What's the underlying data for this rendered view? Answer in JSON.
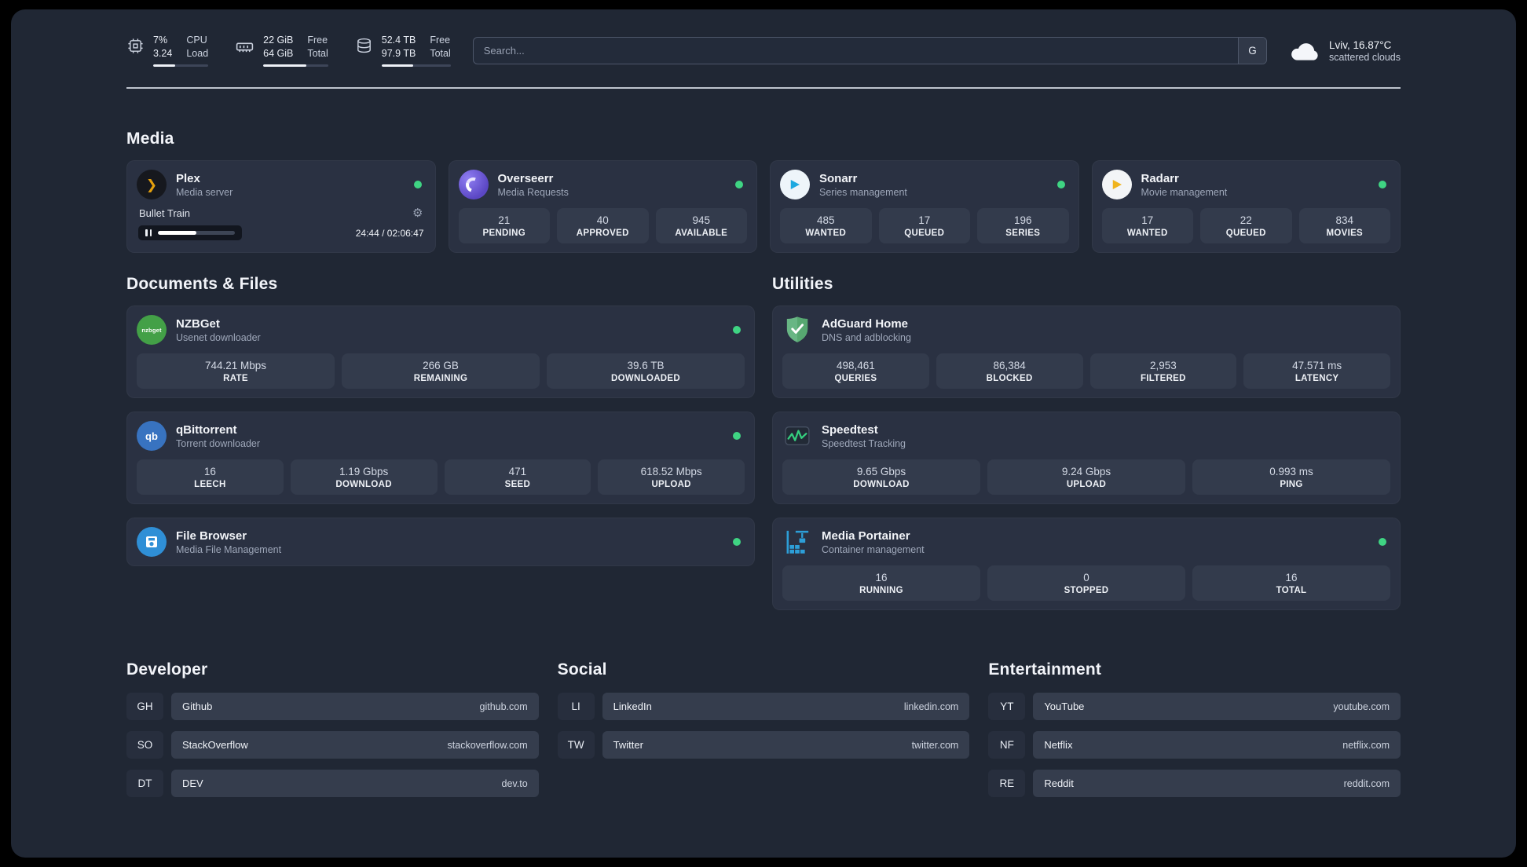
{
  "icons": {
    "gear": "⚙",
    "plex_glyph": "❯"
  },
  "topbar": {
    "cpu": {
      "value1": "7%",
      "value2": "3.24",
      "label1": "CPU",
      "label2": "Load",
      "bar_style": "width:40%"
    },
    "ram": {
      "value1": "22 GiB",
      "value2": "64 GiB",
      "label1": "Free",
      "label2": "Total",
      "bar_style": "width:66%"
    },
    "disk": {
      "value1": "52.4 TB",
      "value2": "97.9 TB",
      "label1": "Free",
      "label2": "Total",
      "bar_style": "width:46%"
    },
    "search": {
      "placeholder": "Search...",
      "engine_button": "G"
    },
    "weather": {
      "location": "Lviv, 16.87°C",
      "condition": "scattered clouds"
    }
  },
  "sections": {
    "media": {
      "title": "Media",
      "plex": {
        "title": "Plex",
        "subtitle": "Media server",
        "now_playing": "Bullet Train",
        "time": "24:44 / 02:06:47",
        "progress_style": "width:50%"
      },
      "overseerr": {
        "title": "Overseerr",
        "subtitle": "Media Requests",
        "stats": [
          {
            "value": "21",
            "label": "PENDING"
          },
          {
            "value": "40",
            "label": "APPROVED"
          },
          {
            "value": "945",
            "label": "AVAILABLE"
          }
        ]
      },
      "sonarr": {
        "title": "Sonarr",
        "subtitle": "Series management",
        "stats": [
          {
            "value": "485",
            "label": "WANTED"
          },
          {
            "value": "17",
            "label": "QUEUED"
          },
          {
            "value": "196",
            "label": "SERIES"
          }
        ]
      },
      "radarr": {
        "title": "Radarr",
        "subtitle": "Movie management",
        "stats": [
          {
            "value": "17",
            "label": "WANTED"
          },
          {
            "value": "22",
            "label": "QUEUED"
          },
          {
            "value": "834",
            "label": "MOVIES"
          }
        ]
      }
    },
    "documents": {
      "title": "Documents & Files",
      "nzbget": {
        "title": "NZBGet",
        "subtitle": "Usenet downloader",
        "icon_text": "nzbget",
        "stats": [
          {
            "value": "744.21 Mbps",
            "label": "RATE"
          },
          {
            "value": "266 GB",
            "label": "REMAINING"
          },
          {
            "value": "39.6 TB",
            "label": "DOWNLOADED"
          }
        ]
      },
      "qbittorrent": {
        "title": "qBittorrent",
        "subtitle": "Torrent downloader",
        "icon_text": "qb",
        "stats": [
          {
            "value": "16",
            "label": "LEECH"
          },
          {
            "value": "1.19 Gbps",
            "label": "DOWNLOAD"
          },
          {
            "value": "471",
            "label": "SEED"
          },
          {
            "value": "618.52 Mbps",
            "label": "UPLOAD"
          }
        ]
      },
      "filebrowser": {
        "title": "File Browser",
        "subtitle": "Media File Management"
      }
    },
    "utilities": {
      "title": "Utilities",
      "adguard": {
        "title": "AdGuard Home",
        "subtitle": "DNS and adblocking",
        "stats": [
          {
            "value": "498,461",
            "label": "QUERIES"
          },
          {
            "value": "86,384",
            "label": "BLOCKED"
          },
          {
            "value": "2,953",
            "label": "FILTERED"
          },
          {
            "value": "47.571 ms",
            "label": "LATENCY"
          }
        ]
      },
      "speedtest": {
        "title": "Speedtest",
        "subtitle": "Speedtest Tracking",
        "stats": [
          {
            "value": "9.65 Gbps",
            "label": "DOWNLOAD"
          },
          {
            "value": "9.24 Gbps",
            "label": "UPLOAD"
          },
          {
            "value": "0.993 ms",
            "label": "PING"
          }
        ]
      },
      "portainer": {
        "title": "Media Portainer",
        "subtitle": "Container management",
        "stats": [
          {
            "value": "16",
            "label": "RUNNING"
          },
          {
            "value": "0",
            "label": "STOPPED"
          },
          {
            "value": "16",
            "label": "TOTAL"
          }
        ]
      }
    }
  },
  "bookmarks": {
    "developer": {
      "title": "Developer",
      "links": [
        {
          "abbr": "GH",
          "name": "Github",
          "url": "github.com"
        },
        {
          "abbr": "SO",
          "name": "StackOverflow",
          "url": "stackoverflow.com"
        },
        {
          "abbr": "DT",
          "name": "DEV",
          "url": "dev.to"
        }
      ]
    },
    "social": {
      "title": "Social",
      "links": [
        {
          "abbr": "LI",
          "name": "LinkedIn",
          "url": "linkedin.com"
        },
        {
          "abbr": "TW",
          "name": "Twitter",
          "url": "twitter.com"
        }
      ]
    },
    "entertainment": {
      "title": "Entertainment",
      "links": [
        {
          "abbr": "YT",
          "name": "YouTube",
          "url": "youtube.com"
        },
        {
          "abbr": "NF",
          "name": "Netflix",
          "url": "netflix.com"
        },
        {
          "abbr": "RE",
          "name": "Reddit",
          "url": "reddit.com"
        }
      ]
    }
  }
}
